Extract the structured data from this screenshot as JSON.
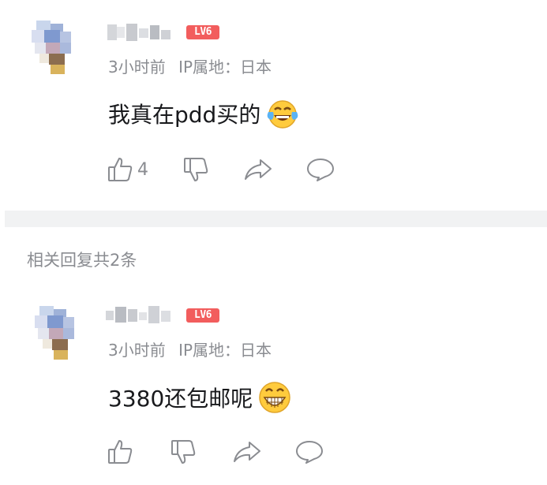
{
  "comments": [
    {
      "username": "",
      "level": "LV6",
      "time": "3小时前",
      "ip_location": "IP属地：日本",
      "text": "我真在pdd买的",
      "emoji": "laugh-cry-emoji",
      "like_count": "4"
    }
  ],
  "replies_header": "相关回复共2条",
  "replies": [
    {
      "username": "",
      "level": "LV6",
      "time": "3小时前",
      "ip_location": "IP属地：日本",
      "text": "3380还包邮呢",
      "emoji": "grin-emoji",
      "like_count": ""
    }
  ],
  "icons": [
    "thumb-up-icon",
    "thumb-down-icon",
    "share-icon",
    "comment-icon"
  ],
  "colors": {
    "level_badge": "#f25d5d",
    "meta_text": "#8a8c91",
    "divider": "#f1f2f3"
  }
}
